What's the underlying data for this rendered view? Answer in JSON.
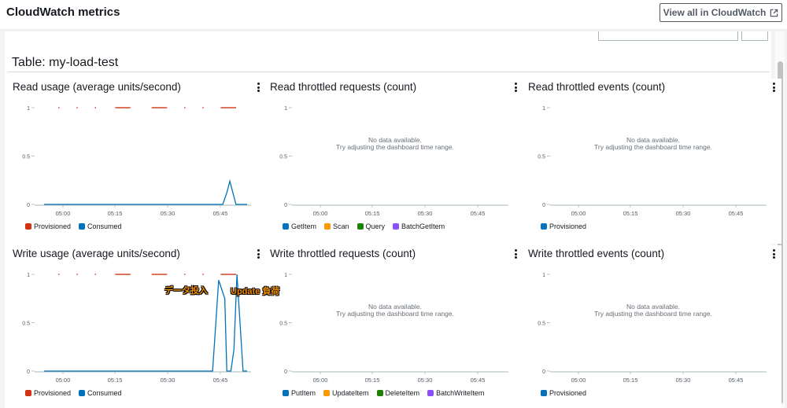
{
  "header": {
    "title": "CloudWatch metrics",
    "view_all_label": "View all in CloudWatch",
    "view_all_icon": "external-link-icon"
  },
  "table_title": "Table: my-load-test",
  "no_data": {
    "line1": "No data available.",
    "line2": "Try adjusting the dashboard time range."
  },
  "annotations": {
    "data_load": "データ投入",
    "update_load": "Update 負荷"
  },
  "colors": {
    "provisioned": "#d13212",
    "consumed": "#0073bb",
    "scan": "#ff9900",
    "query": "#1d8102",
    "batch": "#8c4fff",
    "updateitem": "#ff9900",
    "deleteitem": "#1d8102",
    "batchwrite": "#8c4fff"
  },
  "widgets": [
    {
      "id": "read-usage",
      "title": "Read usage (average units/second)",
      "has_data": true,
      "legend": [
        {
          "label": "Provisioned",
          "color": "#d13212"
        },
        {
          "label": "Consumed",
          "color": "#0073bb"
        }
      ]
    },
    {
      "id": "read-throttled-requests",
      "title": "Read throttled requests (count)",
      "has_data": false,
      "legend": [
        {
          "label": "GetItem",
          "color": "#0073bb"
        },
        {
          "label": "Scan",
          "color": "#ff9900"
        },
        {
          "label": "Query",
          "color": "#1d8102"
        },
        {
          "label": "BatchGetItem",
          "color": "#8c4fff"
        }
      ]
    },
    {
      "id": "read-throttled-events",
      "title": "Read throttled events (count)",
      "has_data": false,
      "legend": [
        {
          "label": "Provisioned",
          "color": "#0073bb"
        }
      ]
    },
    {
      "id": "write-usage",
      "title": "Write usage (average units/second)",
      "has_data": true,
      "legend": [
        {
          "label": "Provisioned",
          "color": "#d13212"
        },
        {
          "label": "Consumed",
          "color": "#0073bb"
        }
      ]
    },
    {
      "id": "write-throttled-requests",
      "title": "Write throttled requests (count)",
      "has_data": false,
      "legend": [
        {
          "label": "PutItem",
          "color": "#0073bb"
        },
        {
          "label": "UpdateItem",
          "color": "#ff9900"
        },
        {
          "label": "DeleteItem",
          "color": "#1d8102"
        },
        {
          "label": "BatchWriteItem",
          "color": "#8c4fff"
        }
      ]
    },
    {
      "id": "write-throttled-events",
      "title": "Write throttled events (count)",
      "has_data": false,
      "legend": [
        {
          "label": "Provisioned",
          "color": "#0073bb"
        }
      ]
    }
  ],
  "chart_data": [
    {
      "type": "line",
      "title": "Read usage (average units/second)",
      "x_ticks": [
        "05:00",
        "05:15",
        "05:30",
        "05:45"
      ],
      "y_ticks": [
        "1",
        "0.5",
        "0"
      ],
      "ylim": [
        0,
        1
      ],
      "series": [
        {
          "name": "Provisioned",
          "color": "#d13212",
          "style": "dashed",
          "points": [
            [
              0.07,
              1
            ],
            [
              0.16,
              1
            ],
            [
              0.25,
              1
            ],
            [
              0.35,
              1
            ],
            [
              0.38,
              1
            ],
            [
              0.42,
              1
            ],
            [
              0.53,
              1
            ],
            [
              0.56,
              1
            ],
            [
              0.6,
              1
            ],
            [
              0.69,
              1
            ],
            [
              0.78,
              1
            ],
            [
              0.87,
              1
            ],
            [
              0.9,
              1
            ],
            [
              0.94,
              1
            ]
          ]
        },
        {
          "name": "Consumed",
          "color": "#0073bb",
          "style": "solid",
          "points": [
            [
              0,
              0
            ],
            [
              0.88,
              0
            ],
            [
              0.9,
              0.12
            ],
            [
              0.915,
              0.24
            ],
            [
              0.93,
              0.12
            ],
            [
              0.945,
              0
            ],
            [
              1,
              0
            ]
          ]
        }
      ]
    },
    {
      "type": "line",
      "title": "Read throttled requests (count)",
      "x_ticks": [
        "05:00",
        "05:15",
        "05:30",
        "05:45"
      ],
      "y_ticks": [
        "1",
        "0.5",
        "0"
      ],
      "ylim": [
        0,
        1
      ],
      "series": []
    },
    {
      "type": "line",
      "title": "Read throttled events (count)",
      "x_ticks": [
        "05:00",
        "05:15",
        "05:30",
        "05:45"
      ],
      "y_ticks": [
        "1",
        "0.5",
        "0"
      ],
      "ylim": [
        0,
        1
      ],
      "series": []
    },
    {
      "type": "line",
      "title": "Write usage (average units/second)",
      "x_ticks": [
        "05:00",
        "05:15",
        "05:30",
        "05:45"
      ],
      "y_ticks": [
        "1",
        "0.5",
        "0"
      ],
      "ylim": [
        0,
        1
      ],
      "series": [
        {
          "name": "Provisioned",
          "color": "#d13212",
          "style": "dashed",
          "points": [
            [
              0.07,
              1
            ],
            [
              0.16,
              1
            ],
            [
              0.25,
              1
            ],
            [
              0.35,
              1
            ],
            [
              0.38,
              1
            ],
            [
              0.42,
              1
            ],
            [
              0.53,
              1
            ],
            [
              0.56,
              1
            ],
            [
              0.6,
              1
            ],
            [
              0.69,
              1
            ],
            [
              0.78,
              1
            ],
            [
              0.87,
              1
            ],
            [
              0.9,
              1
            ],
            [
              0.94,
              1
            ]
          ]
        },
        {
          "name": "Consumed",
          "color": "#0073bb",
          "style": "solid",
          "points": [
            [
              0,
              0
            ],
            [
              0.83,
              0
            ],
            [
              0.86,
              0.94
            ],
            [
              0.89,
              0.75
            ],
            [
              0.9,
              0
            ],
            [
              0.92,
              0
            ],
            [
              0.935,
              0.22
            ],
            [
              0.95,
              1
            ],
            [
              0.965,
              0.5
            ],
            [
              0.98,
              0
            ],
            [
              1,
              0
            ]
          ]
        }
      ]
    },
    {
      "type": "line",
      "title": "Write throttled requests (count)",
      "x_ticks": [
        "05:00",
        "05:15",
        "05:30",
        "05:45"
      ],
      "y_ticks": [
        "1",
        "0.5",
        "0"
      ],
      "ylim": [
        0,
        1
      ],
      "series": []
    },
    {
      "type": "line",
      "title": "Write throttled events (count)",
      "x_ticks": [
        "05:00",
        "05:15",
        "05:30",
        "05:45"
      ],
      "y_ticks": [
        "1",
        "0.5",
        "0"
      ],
      "ylim": [
        0,
        1
      ],
      "series": []
    }
  ]
}
